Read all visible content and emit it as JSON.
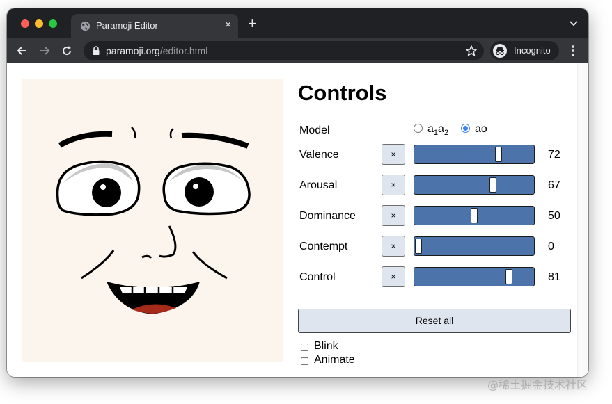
{
  "browser": {
    "tab_title": "Paramoji Editor",
    "tab_close": "×",
    "new_tab": "+",
    "url_domain": "paramoji.org",
    "url_path": "/editor.html",
    "incognito_label": "Incognito"
  },
  "controls": {
    "heading": "Controls",
    "model_label": "Model",
    "model_options": [
      {
        "label_main": "a",
        "sub1": "1",
        "label_mid": "a",
        "sub2": "2",
        "checked": false
      },
      {
        "label": "ao",
        "checked": true
      }
    ],
    "rows": [
      {
        "label": "Valence",
        "value": "72",
        "level": 72
      },
      {
        "label": "Arousal",
        "value": "67",
        "level": 67
      },
      {
        "label": "Dominance",
        "value": "50",
        "level": 50
      },
      {
        "label": "Contempt",
        "value": "0",
        "level": 0
      },
      {
        "label": "Control",
        "value": "81",
        "level": 81
      }
    ],
    "clear_label": "×",
    "reset_label": "Reset all",
    "checkboxes": [
      {
        "label": "Blink",
        "checked": false
      },
      {
        "label": "Animate",
        "checked": false
      }
    ]
  },
  "watermark": "@稀土掘金技术社区",
  "colors": {
    "slider_fill": "#4d73ab",
    "button_bg": "#dfe5ee",
    "face_bg": "#fcf5ee",
    "radio_accent": "#3b82f6"
  },
  "icons": [
    "globe-icon",
    "close-icon",
    "plus-icon",
    "chevron-down-icon",
    "back-arrow-icon",
    "forward-arrow-icon",
    "reload-icon",
    "lock-icon",
    "star-icon",
    "incognito-icon",
    "kebab-menu-icon"
  ]
}
